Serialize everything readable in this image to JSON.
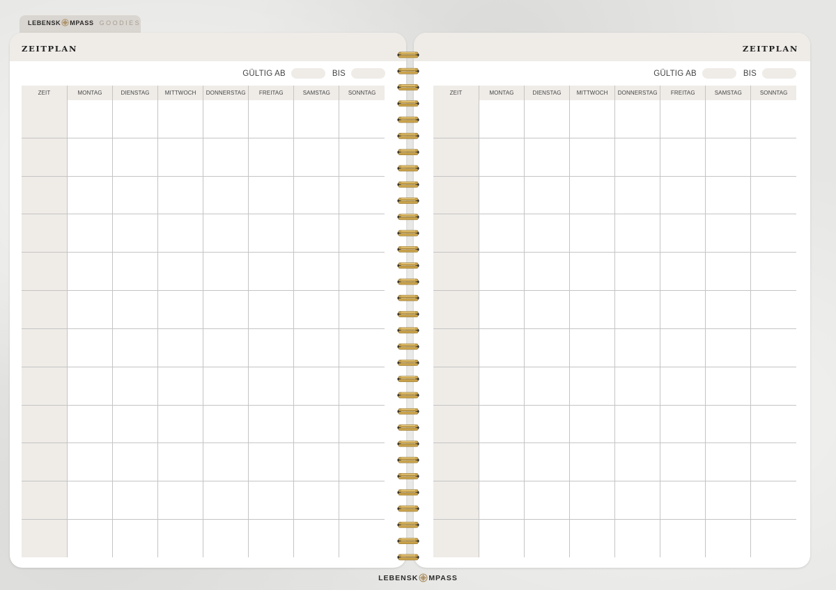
{
  "brand": {
    "name_part1": "LEBENSK",
    "name_part2": "MPASS",
    "tab_label": "GOODIES"
  },
  "colors": {
    "header_fill": "#efece8",
    "spiral_gold": "#c9a24a",
    "grid_line": "#c4c4c4",
    "background": "#e6e6e4"
  },
  "pages": {
    "left": {
      "title": "ZEITPLAN",
      "valid_from_label": "GÜLTIG AB",
      "valid_to_label": "BIS"
    },
    "right": {
      "title": "ZEITPLAN",
      "valid_from_label": "GÜLTIG AB",
      "valid_to_label": "BIS"
    }
  },
  "columns": [
    "ZEIT",
    "MONTAG",
    "DIENSTAG",
    "MITTWOCH",
    "DONNERSTAG",
    "FREITAG",
    "SAMSTAG",
    "SONNTAG"
  ],
  "row_count": 12,
  "footer": {
    "name_part1": "LEBENSK",
    "name_part2": "MPASS"
  }
}
